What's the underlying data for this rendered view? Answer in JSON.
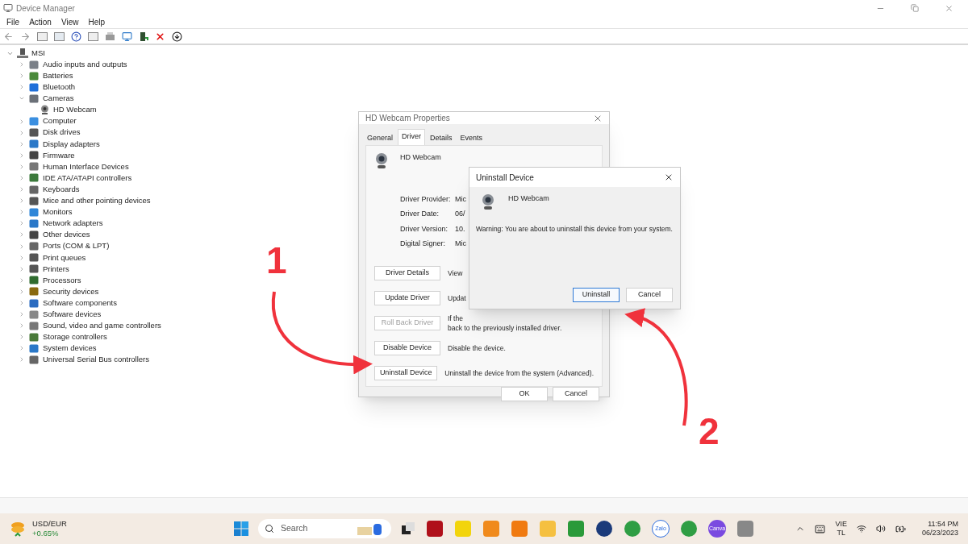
{
  "window": {
    "title": "Device Manager"
  },
  "menu": [
    "File",
    "Action",
    "View",
    "Help"
  ],
  "tree": {
    "root": "MSI",
    "expanded": true,
    "items": [
      {
        "label": "Audio inputs and outputs",
        "expanded": false
      },
      {
        "label": "Batteries",
        "expanded": false
      },
      {
        "label": "Bluetooth",
        "expanded": false
      },
      {
        "label": "Cameras",
        "expanded": true,
        "children": [
          {
            "label": "HD Webcam"
          }
        ]
      },
      {
        "label": "Computer",
        "expanded": false
      },
      {
        "label": "Disk drives",
        "expanded": false
      },
      {
        "label": "Display adapters",
        "expanded": false
      },
      {
        "label": "Firmware",
        "expanded": false
      },
      {
        "label": "Human Interface Devices",
        "expanded": false
      },
      {
        "label": "IDE ATA/ATAPI controllers",
        "expanded": false
      },
      {
        "label": "Keyboards",
        "expanded": false
      },
      {
        "label": "Mice and other pointing devices",
        "expanded": false
      },
      {
        "label": "Monitors",
        "expanded": false
      },
      {
        "label": "Network adapters",
        "expanded": false
      },
      {
        "label": "Other devices",
        "expanded": false
      },
      {
        "label": "Ports (COM & LPT)",
        "expanded": false
      },
      {
        "label": "Print queues",
        "expanded": false
      },
      {
        "label": "Printers",
        "expanded": false
      },
      {
        "label": "Processors",
        "expanded": false
      },
      {
        "label": "Security devices",
        "expanded": false
      },
      {
        "label": "Software components",
        "expanded": false
      },
      {
        "label": "Software devices",
        "expanded": false
      },
      {
        "label": "Sound, video and game controllers",
        "expanded": false
      },
      {
        "label": "Storage controllers",
        "expanded": false
      },
      {
        "label": "System devices",
        "expanded": false
      },
      {
        "label": "Universal Serial Bus controllers",
        "expanded": false
      }
    ]
  },
  "properties_dialog": {
    "title": "HD Webcam Properties",
    "tabs": [
      {
        "label": "General",
        "selected": false
      },
      {
        "label": "Driver",
        "selected": true
      },
      {
        "label": "Details",
        "selected": false
      },
      {
        "label": "Events",
        "selected": false
      }
    ],
    "device_name": "HD Webcam",
    "fields": [
      {
        "label": "Driver Provider:",
        "value": "Mic"
      },
      {
        "label": "Driver Date:",
        "value": "06/"
      },
      {
        "label": "Driver Version:",
        "value": "10."
      },
      {
        "label": "Digital Signer:",
        "value": "Mic"
      }
    ],
    "actions": [
      {
        "button": "Driver Details",
        "disabled": false,
        "description": [
          "View"
        ]
      },
      {
        "button": "Update Driver",
        "disabled": false,
        "description": [
          "Updat"
        ]
      },
      {
        "button": "Roll Back Driver",
        "disabled": true,
        "description": [
          "If the",
          "back to the previously installed driver."
        ]
      },
      {
        "button": "Disable Device",
        "disabled": false,
        "description": [
          "Disable the device."
        ]
      },
      {
        "button": "Uninstall Device",
        "disabled": false,
        "description": [
          "Uninstall the device from the system (Advanced)."
        ]
      }
    ],
    "buttons": [
      "OK",
      "Cancel"
    ]
  },
  "uninstall_dialog": {
    "title": "Uninstall Device",
    "device_name": "HD Webcam",
    "warning": "Warning: You are about to uninstall this device from your system.",
    "buttons": [
      {
        "label": "Uninstall",
        "default": true
      },
      {
        "label": "Cancel",
        "default": false
      }
    ]
  },
  "annotations": [
    {
      "label": "1"
    },
    {
      "label": "2"
    }
  ],
  "taskbar": {
    "widget": {
      "title": "USD/EUR",
      "change": "+0.65%"
    },
    "search": {
      "placeholder": "Search"
    },
    "app_labels": [
      "Zalo",
      "Canva"
    ],
    "language": [
      "VIE",
      "TL"
    ],
    "time": "11:54 PM",
    "date": "06/23/2023"
  }
}
